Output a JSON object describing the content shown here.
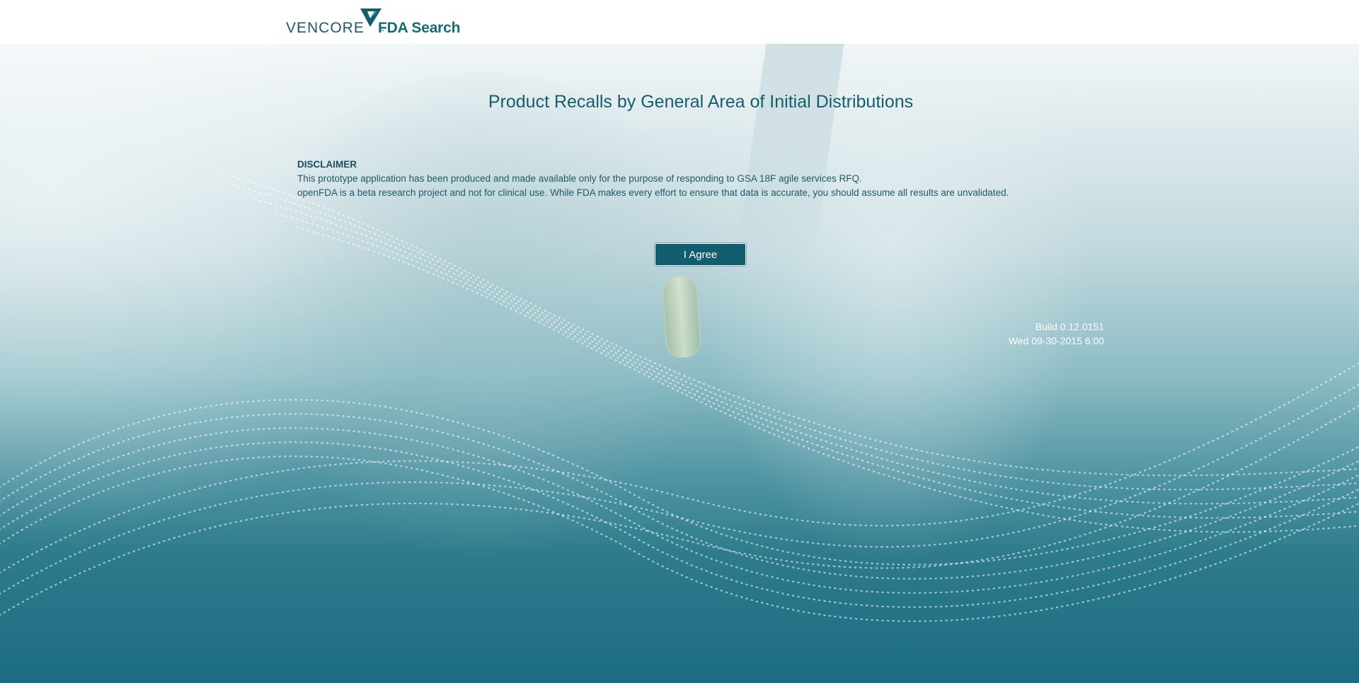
{
  "header": {
    "logo_text": "VENCORE",
    "logo_tm": "™",
    "app_name": "FDA Search"
  },
  "main": {
    "title": "Product Recalls by General Area of Initial Distributions",
    "disclaimer": {
      "heading": "DISCLAIMER",
      "line1": "This prototype application has been produced and made available only for the purpose of responding to GSA 18F agile services RFQ.",
      "line2": "openFDA is a beta research project and not for clinical use. While FDA makes every effort to ensure that data is accurate, you should assume all results are unvalidated."
    },
    "agree_button": "I Agree",
    "build": {
      "version": "Build 0.12.0151",
      "date": "Wed 09-30-2015 6:00"
    }
  },
  "colors": {
    "brand_teal": "#156b73",
    "button_bg": "#0f5d6e",
    "title_text": "#175e6c"
  },
  "icons": {
    "logo_mark": "vencore-triangle-icon"
  }
}
